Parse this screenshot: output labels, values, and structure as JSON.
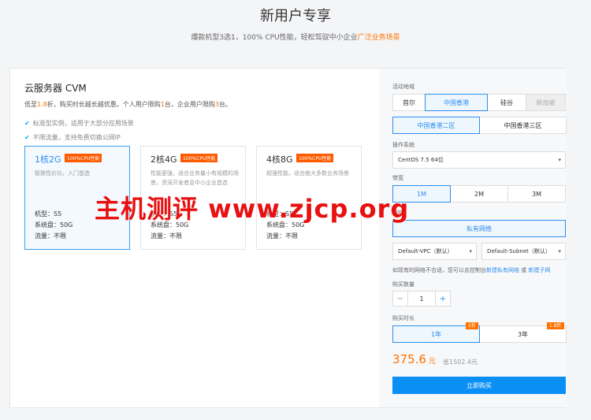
{
  "hero": {
    "title": "新用户专享",
    "subtitle_pre": "爆款机型3选1，100% CPU性能，轻松驾驭中小企业",
    "subtitle_hl": "广泛业务场景"
  },
  "product": {
    "title": "云服务器 CVM",
    "desc": [
      {
        "t": "低至",
        "hl": false
      },
      {
        "t": "1.8",
        "hl": true
      },
      {
        "t": "折，购买时长越长越优惠。个人用户限购",
        "hl": false
      },
      {
        "t": "1",
        "hl": true
      },
      {
        "t": "台，企业用户限购",
        "hl": false
      },
      {
        "t": "3",
        "hl": true
      },
      {
        "t": "台。",
        "hl": false
      }
    ],
    "features": [
      "标准型实例，适用于大部分应用场景",
      "不限流量，支持免费切换公网IP"
    ],
    "check": "✔"
  },
  "specs": [
    {
      "name": "1核2G",
      "badge": "100%CPU性能",
      "desc": "极致性价比，入门首选",
      "model": "机型：S5",
      "disk": "系统盘：50G",
      "traffic": "流量：不限",
      "active": true
    },
    {
      "name": "2核4G",
      "badge": "100%CPU性能",
      "desc": "性能更强，适合业务量小有规模的场景，资深开发者及中小企业首选",
      "model": "机型：S5",
      "disk": "系统盘：50G",
      "traffic": "流量：不限",
      "active": false
    },
    {
      "name": "4核8G",
      "badge": "100%CPU性能",
      "desc": "超强性能，适合绝大多数业务场景",
      "model": "机型：S5",
      "disk": "系统盘：50G",
      "traffic": "流量：不限",
      "active": false
    }
  ],
  "config": {
    "region_label": "活动地域",
    "regions": [
      "首尔",
      "中国香港",
      "硅谷",
      "新加坡"
    ],
    "zones": [
      "中国香港二区",
      "中国香港三区"
    ],
    "os_label": "操作系统",
    "os_value": "CentOS 7.5 64位",
    "bw_label": "带宽",
    "bandwidth": [
      "1M",
      "2M",
      "3M"
    ],
    "net_label": "网络",
    "net_value": "私有网络",
    "vpc": "Default-VPC（默认）",
    "subnet": "Default-Subnet（默认）",
    "hint_pre": "如现有的网络不合适，您可以去控制台",
    "hint_link1": "新建私有网络",
    "hint_mid": "或",
    "hint_link2": "新建子网",
    "qty_label": "购买数量",
    "qty_value": "1",
    "minus": "−",
    "plus": "+",
    "dur_label": "购买时长",
    "durations": [
      {
        "label": "1年",
        "badge": "2折"
      },
      {
        "label": "3年",
        "badge": "1.8折"
      }
    ],
    "price": "375.6",
    "price_unit": " 元",
    "orig_price": "省1502.4元",
    "buy": "立即购买",
    "caret": "▾"
  },
  "watermark": "主机测评 www.zjcp.org",
  "colors": {
    "accent": "#2f8ef0",
    "orange": "#ff7200",
    "buy": "#0a8ff5"
  }
}
